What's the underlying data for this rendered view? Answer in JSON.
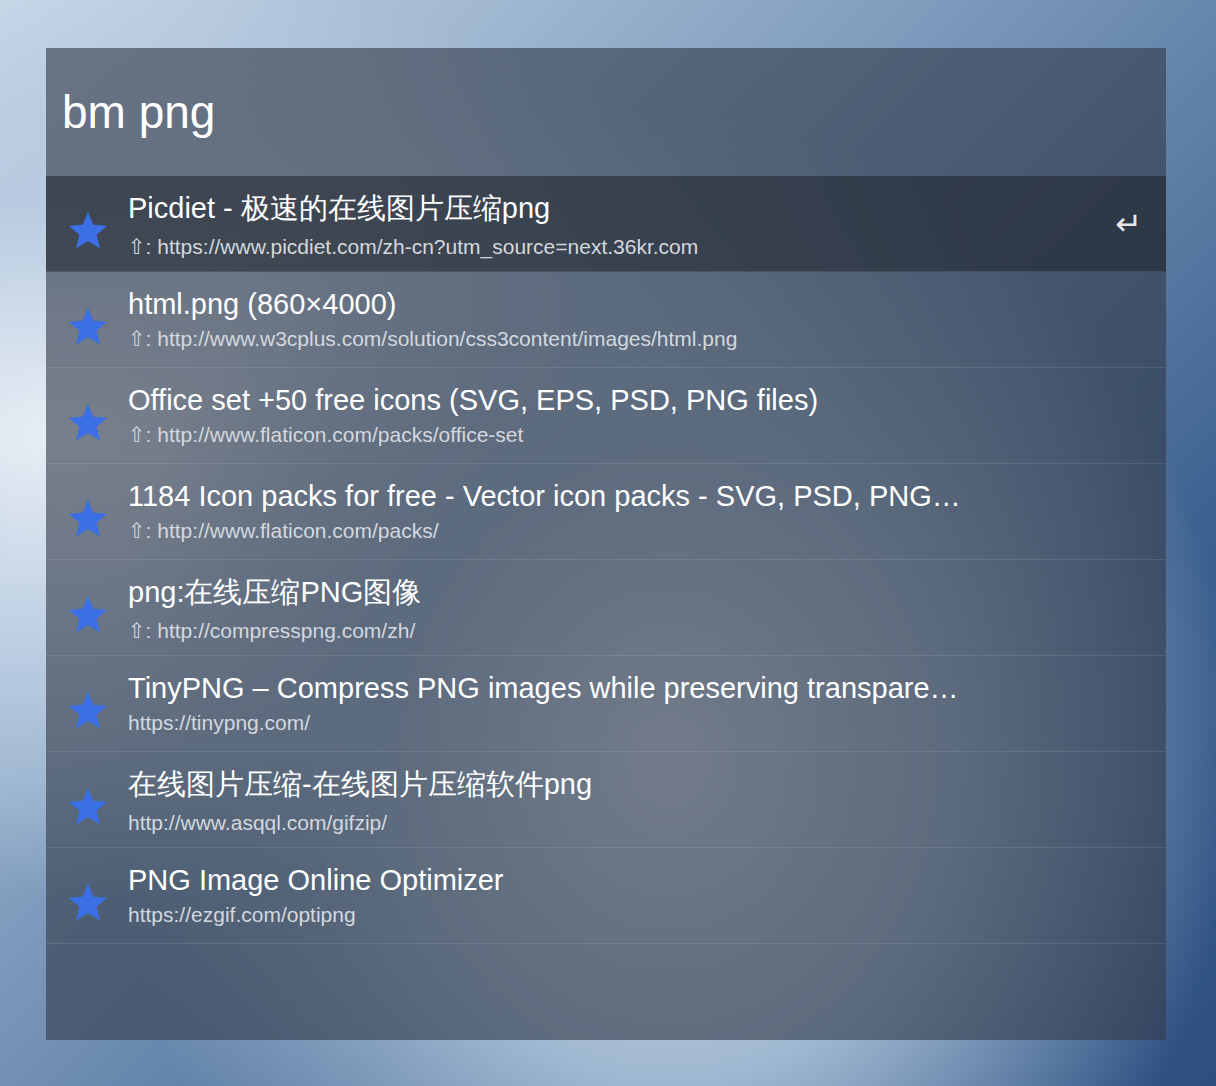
{
  "launcher": {
    "query": "bm png",
    "enter_glyph": "↵",
    "results": [
      {
        "title": "Picdiet - 极速的在线图片压缩png",
        "subtitle": "⇧: https://www.picdiet.com/zh-cn?utm_source=next.36kr.com",
        "selected": true
      },
      {
        "title": "html.png (860×4000)",
        "subtitle": "⇧: http://www.w3cplus.com/solution/css3content/images/html.png",
        "selected": false
      },
      {
        "title": "Office set +50 free icons (SVG, EPS, PSD, PNG files)",
        "subtitle": "⇧: http://www.flaticon.com/packs/office-set",
        "selected": false
      },
      {
        "title": "1184 Icon packs for free - Vector icon packs - SVG, PSD, PNG…",
        "subtitle": "⇧: http://www.flaticon.com/packs/",
        "selected": false
      },
      {
        "title": "png:在线压缩PNG图像",
        "subtitle": "⇧: http://compresspng.com/zh/",
        "selected": false
      },
      {
        "title": "TinyPNG – Compress PNG images while preserving transpare…",
        "subtitle": "https://tinypng.com/",
        "selected": false
      },
      {
        "title": "在线图片压缩-在线图片压缩软件png",
        "subtitle": "http://www.asqql.com/gifzip/",
        "selected": false
      },
      {
        "title": "PNG Image Online Optimizer",
        "subtitle": "https://ezgif.com/optipng",
        "selected": false
      }
    ]
  }
}
